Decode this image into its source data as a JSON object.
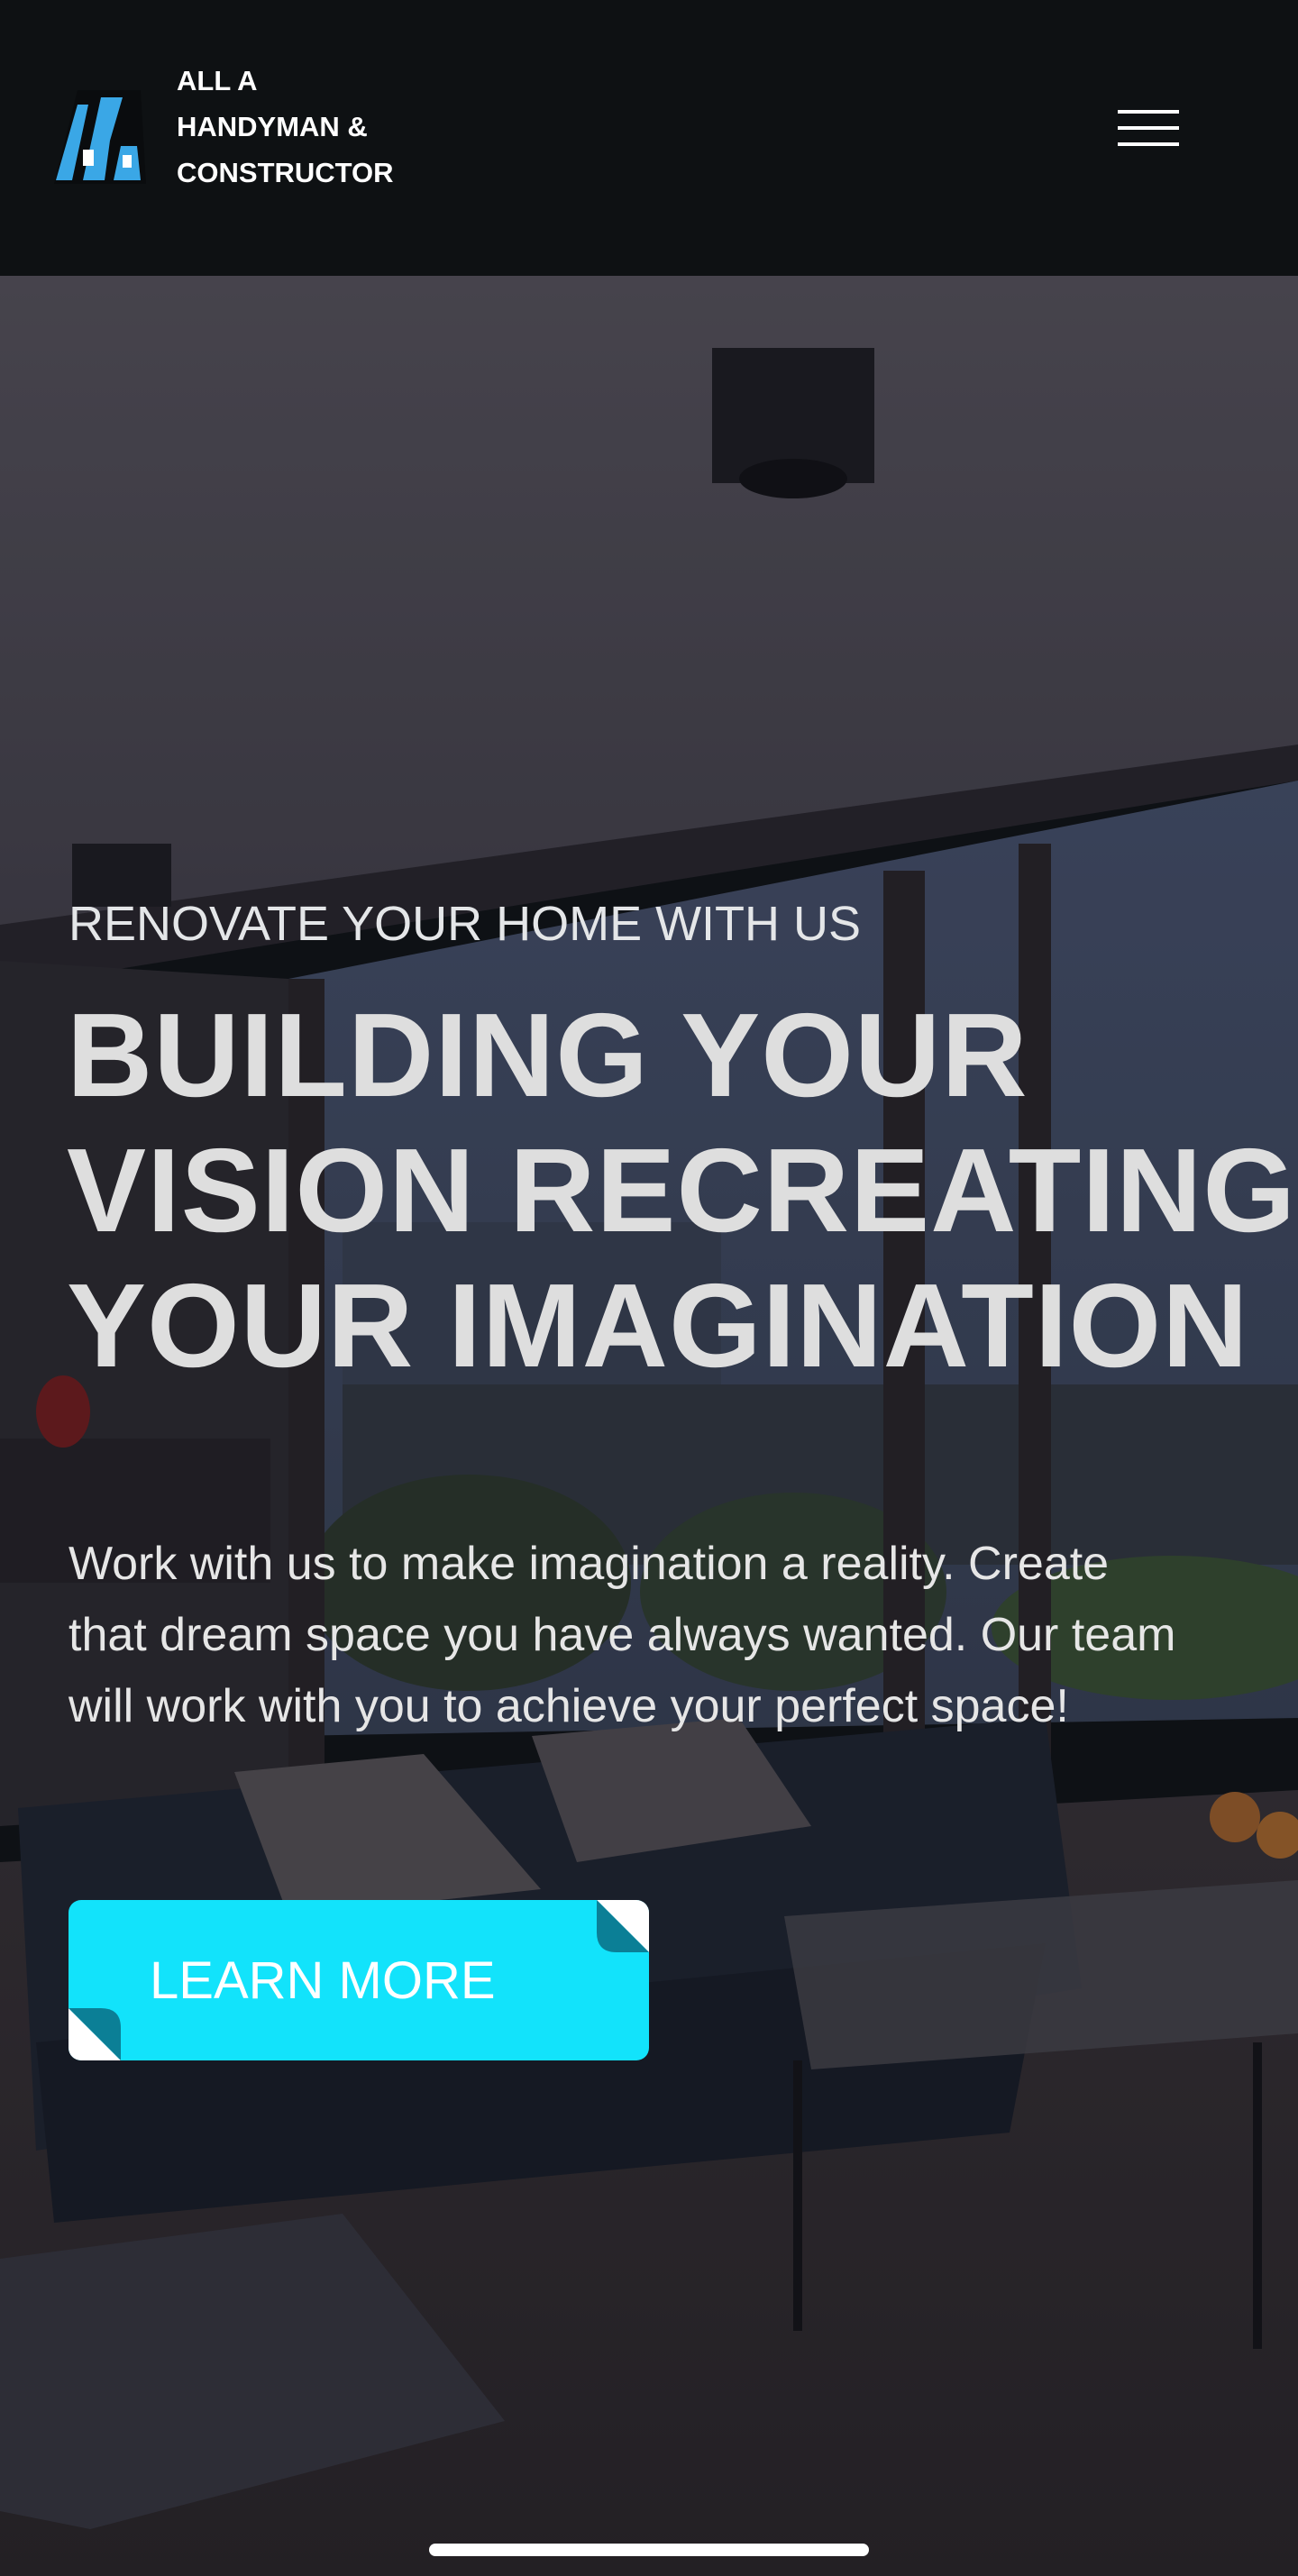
{
  "header": {
    "brand_name": "ALL A\nHANDYMAN &\nCONSTRUCTOR",
    "menu_icon": "hamburger-menu-icon"
  },
  "hero": {
    "eyebrow": "RENOVATE YOUR HOME WITH US",
    "headline": [
      "BUILDING YOUR",
      "VISION RECREATING",
      "YOUR IMAGINATION"
    ],
    "description": "Work with us to make imagination a reality. Create that dream space you have always wanted. Our team will work with you to achieve your perfect space!",
    "cta_label": "LEARN MORE"
  },
  "colors": {
    "header_bg": "#0e1113",
    "cta_bg": "#12e3fb",
    "cta_corner": "#0b7f96",
    "logo_blue": "#3aa7e6",
    "headline_text": "#dedede"
  }
}
